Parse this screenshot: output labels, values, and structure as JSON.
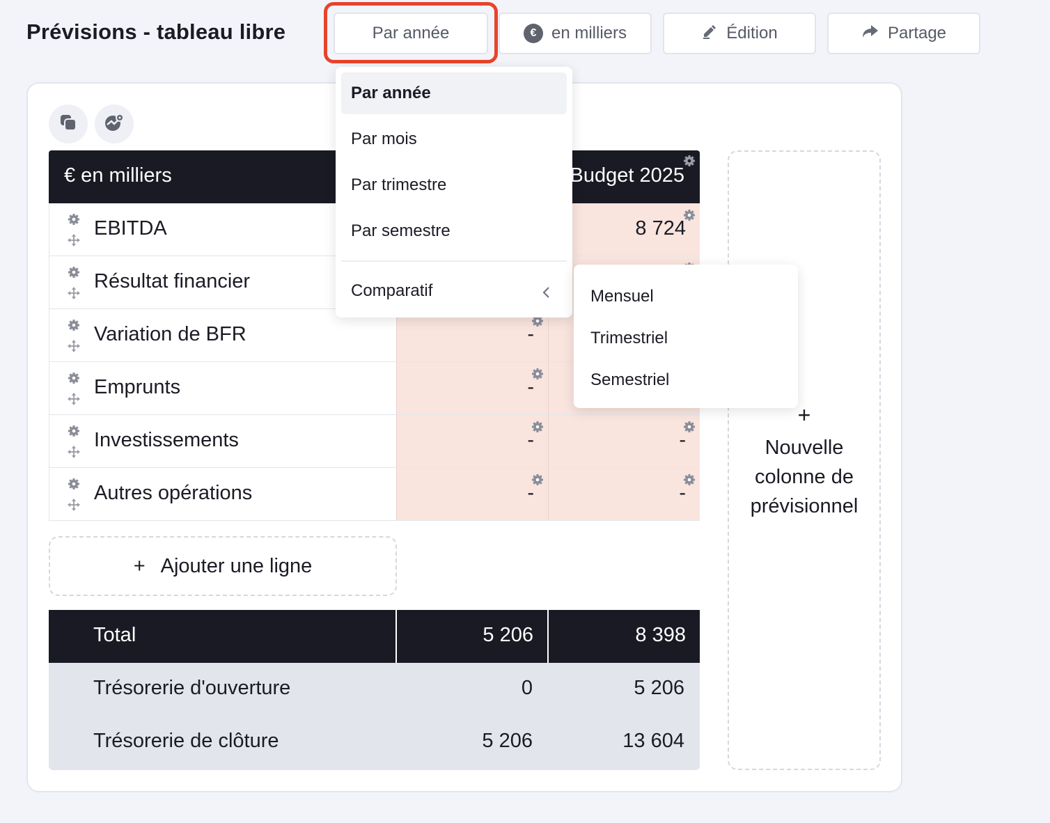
{
  "header": {
    "title": "Prévisions - tableau libre",
    "period_button": "Par année",
    "unit_button": "en milliers",
    "unit_symbol": "€",
    "edit_button": "Édition",
    "share_button": "Partage"
  },
  "toolbar": {
    "icons": [
      "copy-icon",
      "chart-settings-icon"
    ]
  },
  "table": {
    "header_label": "€ en milliers",
    "column_headers": [
      "",
      "Budget 2025"
    ],
    "rows": [
      {
        "label": "EBITDA",
        "values": [
          "",
          "8 724"
        ]
      },
      {
        "label": "Résultat financier",
        "values": [
          "",
          ""
        ]
      },
      {
        "label": "Variation de BFR",
        "values": [
          "-",
          ""
        ]
      },
      {
        "label": "Emprunts",
        "values": [
          "-",
          ""
        ]
      },
      {
        "label": "Investissements",
        "values": [
          "-",
          "-"
        ]
      },
      {
        "label": "Autres opérations",
        "values": [
          "-",
          "-"
        ]
      }
    ],
    "add_line": "Ajouter une ligne",
    "add_line_icon": "+",
    "total": {
      "label": "Total",
      "values": [
        "5 206",
        "8 398"
      ]
    },
    "summary": [
      {
        "label": "Trésorerie d'ouverture",
        "values": [
          "0",
          "5 206"
        ]
      },
      {
        "label": "Trésorerie de clôture",
        "values": [
          "5 206",
          "13 604"
        ]
      }
    ]
  },
  "new_column": {
    "icon": "+",
    "label_lines": [
      "Nouvelle",
      "colonne de",
      "prévisionnel"
    ]
  },
  "dropdown": {
    "items": [
      "Par année",
      "Par mois",
      "Par trimestre",
      "Par semestre"
    ],
    "selected": "Par année",
    "comparatif": "Comparatif",
    "submenu": [
      "Mensuel",
      "Trimestriel",
      "Semestriel"
    ]
  },
  "colors": {
    "accent_highlight": "#e8432b",
    "table_header_bg": "#191a23",
    "cell_bg": "#f9e4de",
    "summary_bg": "#e3e5ec"
  }
}
